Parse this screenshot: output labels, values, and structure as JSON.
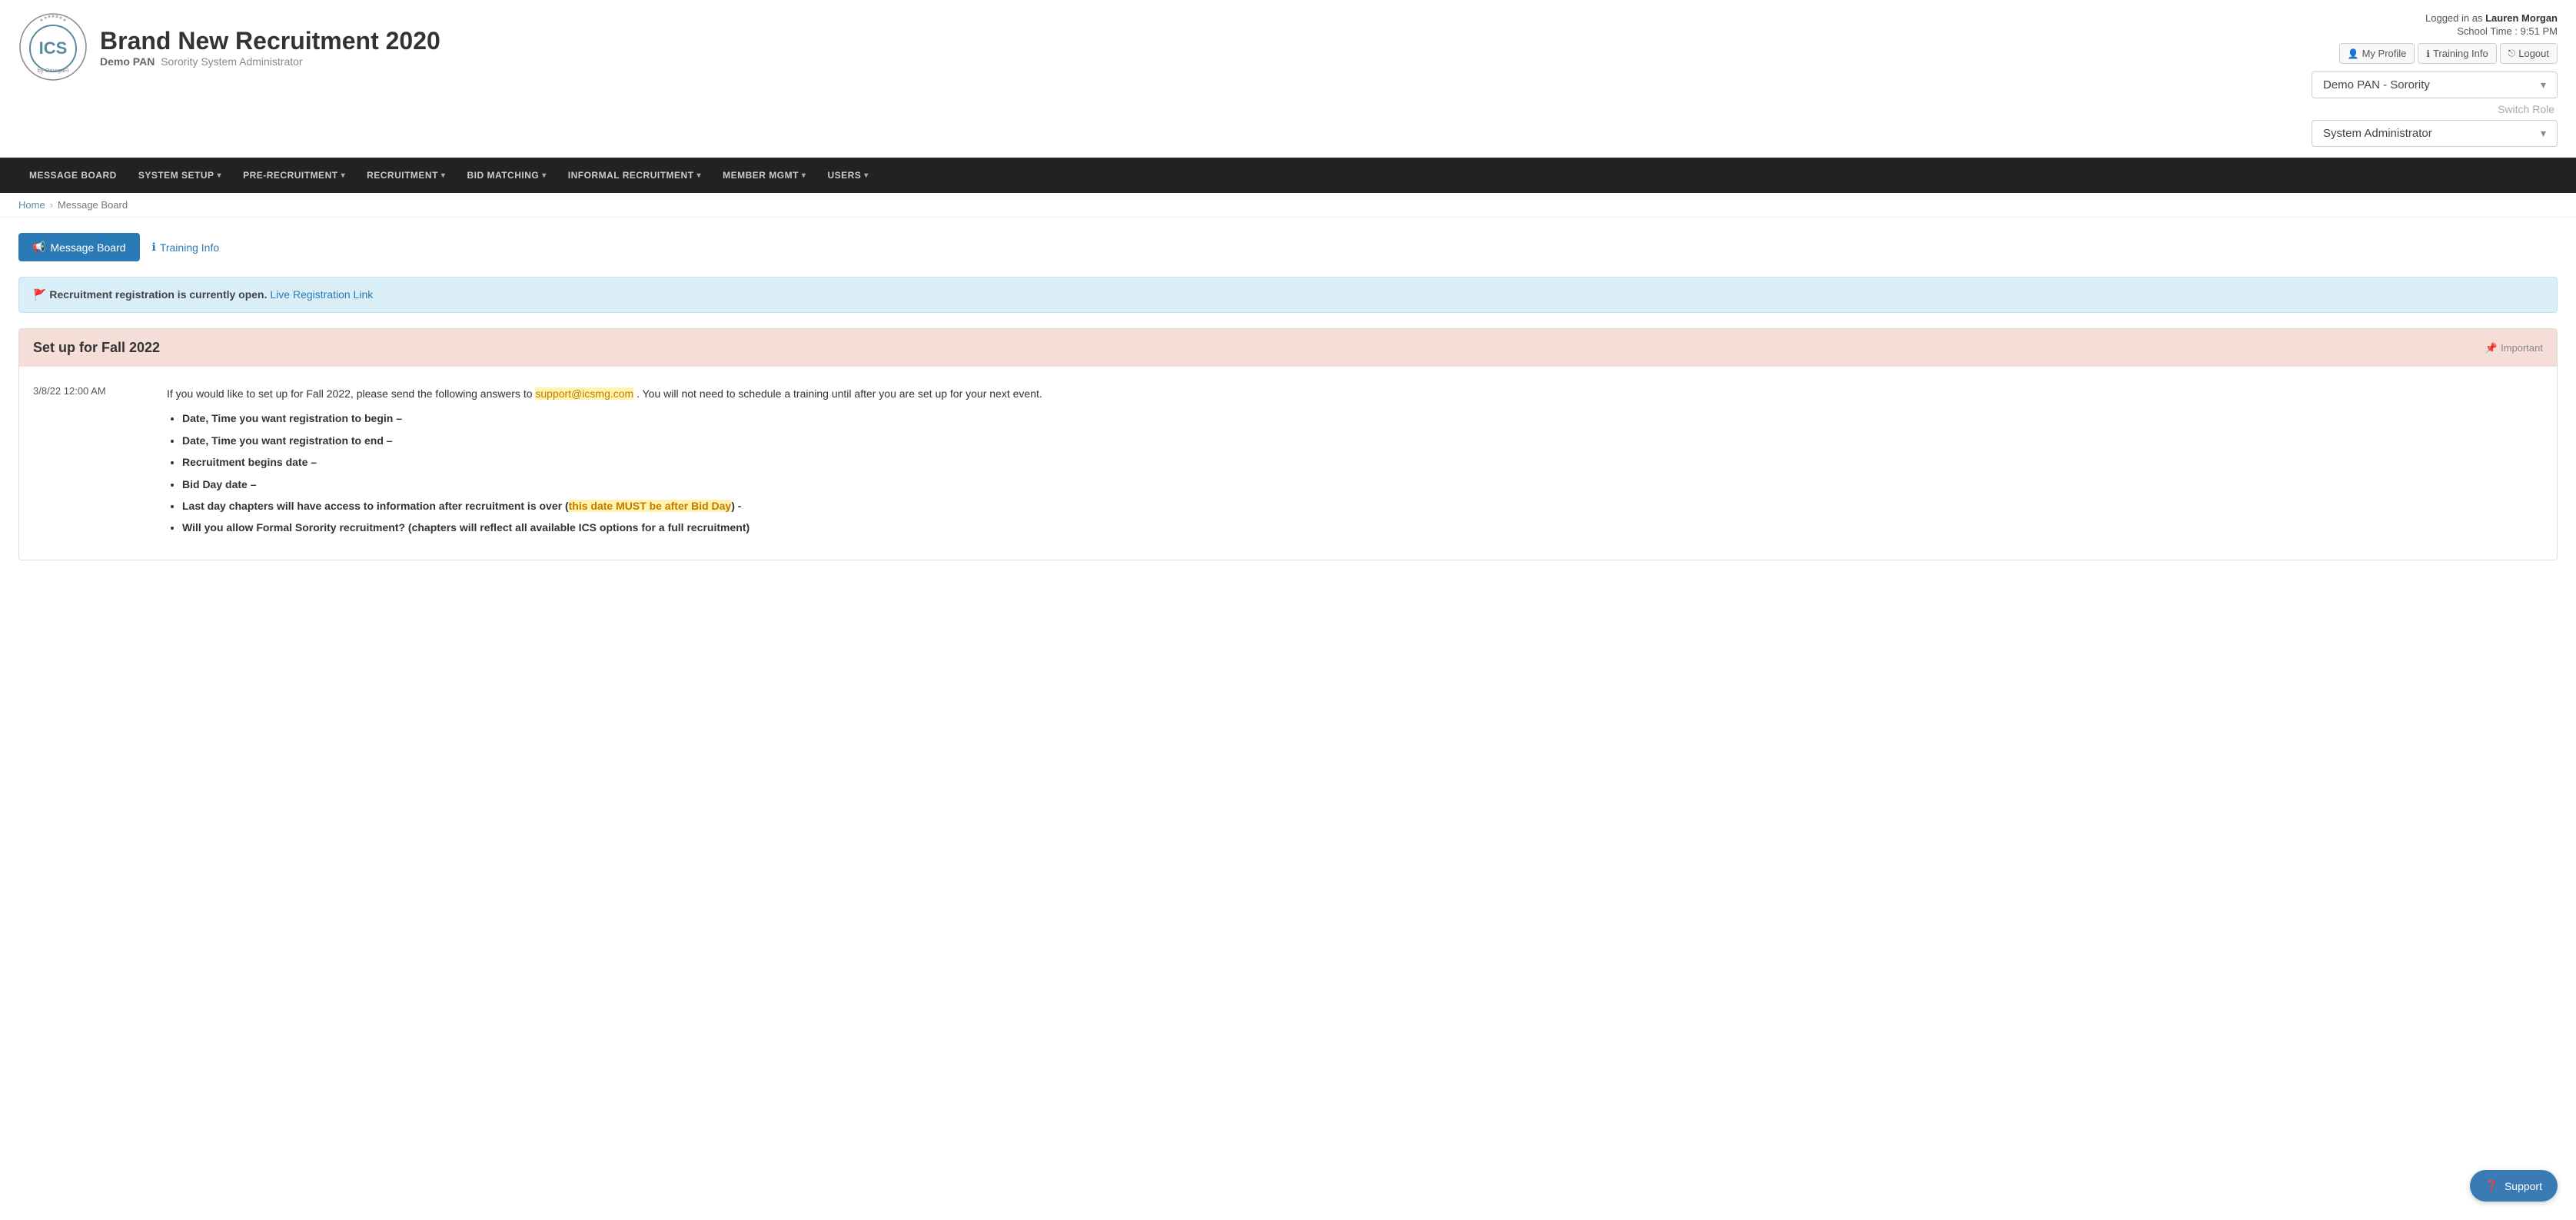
{
  "header": {
    "app_name": "Brand New Recruitment 2020",
    "org_name": "Demo PAN",
    "org_sub": "Sorority System Administrator",
    "logged_in_label": "Logged in as",
    "logged_in_user": "Lauren Morgan",
    "school_time_label": "School Time :",
    "school_time_value": "9:51 PM",
    "my_profile_label": "My Profile",
    "training_info_label": "Training Info",
    "logout_label": "Logout",
    "role_dropdown": "Demo PAN - Sorority",
    "switch_role_label": "Switch Role",
    "role_select": "System Administrator"
  },
  "navbar": {
    "items": [
      {
        "label": "Message Board",
        "has_arrow": false
      },
      {
        "label": "System Setup",
        "has_arrow": true
      },
      {
        "label": "Pre-Recruitment",
        "has_arrow": true
      },
      {
        "label": "Recruitment",
        "has_arrow": true
      },
      {
        "label": "Bid Matching",
        "has_arrow": true
      },
      {
        "label": "Informal Recruitment",
        "has_arrow": true
      },
      {
        "label": "Member Mgmt",
        "has_arrow": true
      },
      {
        "label": "Users",
        "has_arrow": true
      }
    ]
  },
  "breadcrumb": {
    "home": "Home",
    "current": "Message Board"
  },
  "actions": {
    "message_board_btn": "Message Board",
    "training_info_link": "Training Info"
  },
  "alert": {
    "text": "Recruitment registration is currently open.",
    "link_label": "Live Registration Link",
    "link_href": "#"
  },
  "message_board": {
    "title": "Set up for Fall 2022",
    "important_label": "Important",
    "date": "3/8/22 12:00 AM",
    "intro": "If you would like to set up for Fall 2022, please send the following answers to",
    "email": "support@icsmg.com",
    "email_suffix": ". You will not need to schedule a training until after you are set up for your next event.",
    "bullets": [
      "Date, Time you want registration to begin –",
      "Date, Time you want registration to end –",
      "Recruitment begins date –",
      "Bid Day date –",
      "Last day chapters will have access to information after recruitment is over (this date MUST be after Bid Day) -",
      "Will you allow Formal Sorority recruitment? (chapters will reflect all available ICS options for a full recruitment)"
    ],
    "highlight_text": "this date MUST be after Bid Day"
  },
  "support": {
    "label": "Support"
  },
  "logo": {
    "ics": "ICS",
    "byline": "by OmegaFi"
  }
}
